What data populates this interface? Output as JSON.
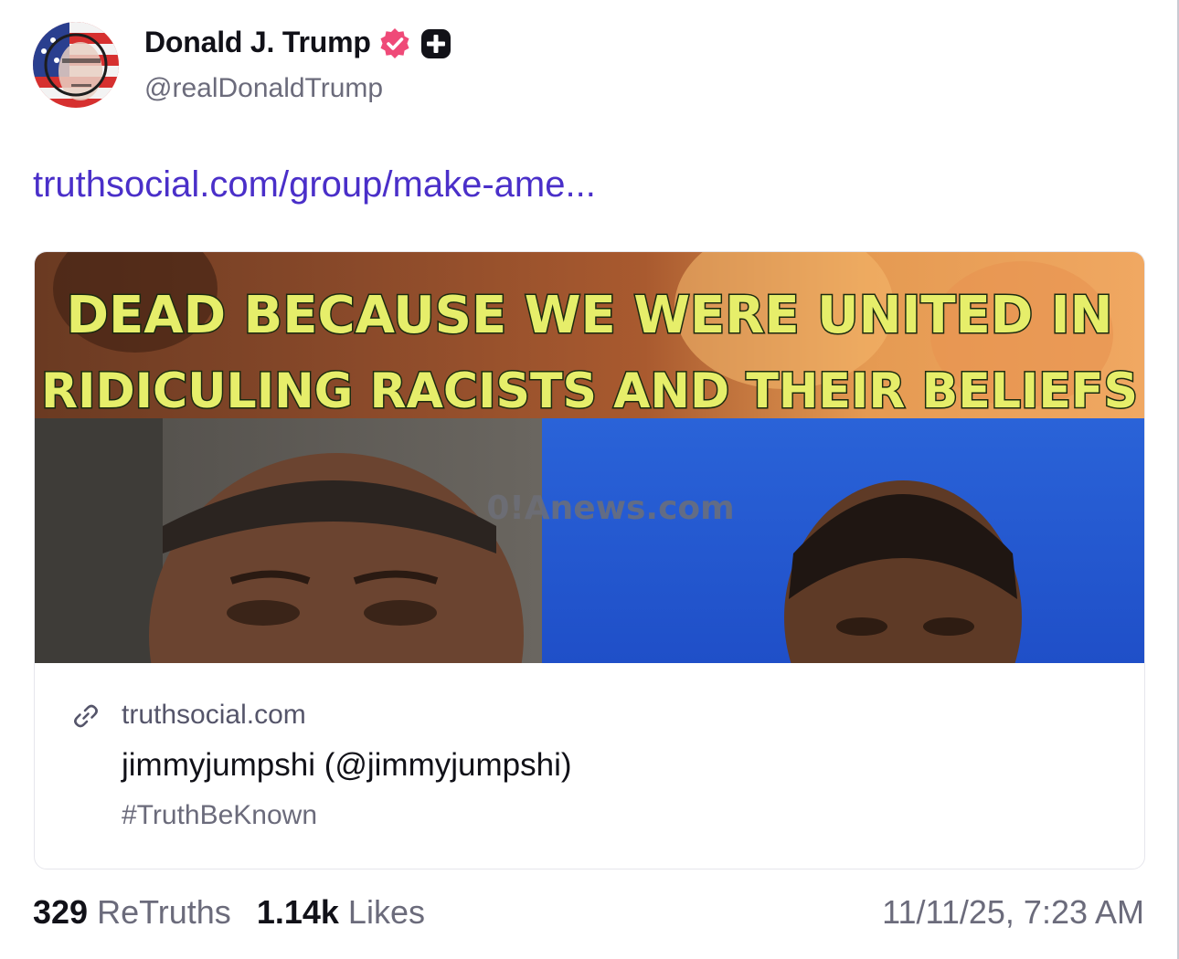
{
  "author": {
    "display_name": "Donald J. Trump",
    "handle": "@realDonaldTrump",
    "verified_icon": "verified-check-icon",
    "plus_icon": "plus-badge-icon",
    "verified_color": "#ef4a78"
  },
  "post": {
    "link_text": "truthsocial.com/group/make-ame...",
    "link_color": "#4a2fc9"
  },
  "card": {
    "image": {
      "caption_line1": "DEAD BECAUSE WE WERE UNITED IN",
      "caption_line2": "RIDICULING RACISTS AND THEIR BELIEFS",
      "watermark": "0!Anews.com"
    },
    "link_icon": "link-icon",
    "domain": "truthsocial.com",
    "title": "jimmyjumpshi (@jimmyjumpshi)",
    "description": "#TruthBeKnown"
  },
  "footer": {
    "retruths_count": "329",
    "retruths_label": "ReTruths",
    "likes_count": "1.14k",
    "likes_label": "Likes",
    "timestamp": "11/11/25, 7:23 AM"
  }
}
